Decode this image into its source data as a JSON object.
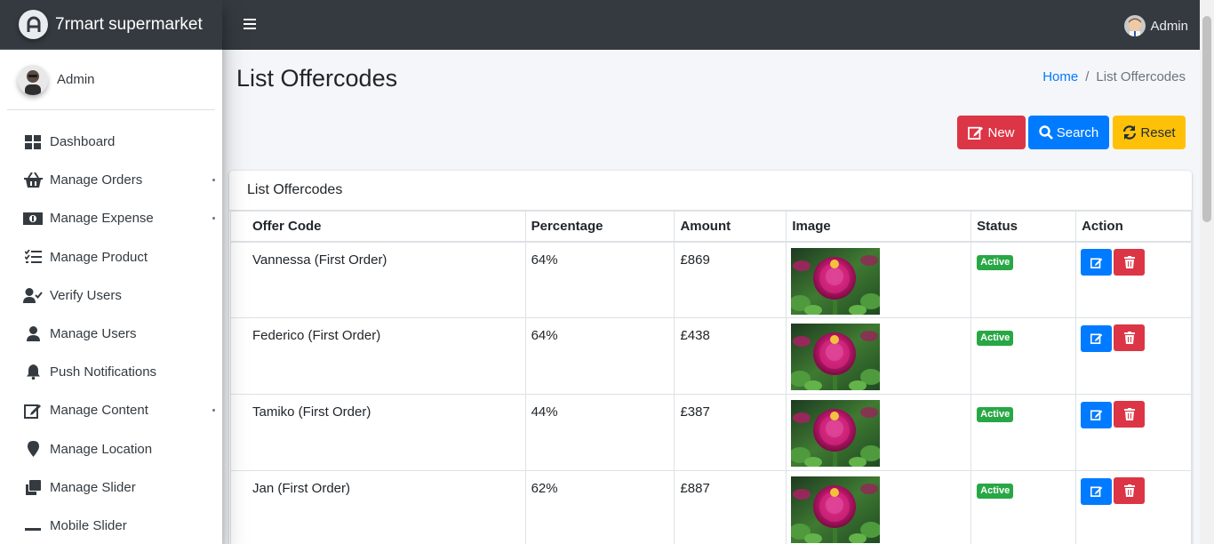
{
  "brand": {
    "name": "7rmart supermarket"
  },
  "sidebar": {
    "user": "Admin",
    "items": [
      {
        "label": "Dashboard",
        "icon": "dashboard-icon",
        "has_submenu": false
      },
      {
        "label": "Manage Orders",
        "icon": "basket-icon",
        "has_submenu": true
      },
      {
        "label": "Manage Expense",
        "icon": "money-bill-icon",
        "has_submenu": true
      },
      {
        "label": "Manage Product",
        "icon": "tasks-icon",
        "has_submenu": false
      },
      {
        "label": "Verify Users",
        "icon": "user-check-icon",
        "has_submenu": false
      },
      {
        "label": "Manage Users",
        "icon": "user-icon",
        "has_submenu": false
      },
      {
        "label": "Push Notifications",
        "icon": "bell-icon",
        "has_submenu": false
      },
      {
        "label": "Manage Content",
        "icon": "edit-icon",
        "has_submenu": true
      },
      {
        "label": "Manage Location",
        "icon": "map-marker-icon",
        "has_submenu": false
      },
      {
        "label": "Manage Slider",
        "icon": "clone-icon",
        "has_submenu": false
      },
      {
        "label": "Mobile Slider",
        "icon": "minus-icon",
        "has_submenu": false
      }
    ]
  },
  "topbar": {
    "user": "Admin"
  },
  "page": {
    "title": "List Offercodes",
    "breadcrumb": {
      "home": "Home",
      "separator": "/",
      "current": "List Offercodes"
    }
  },
  "buttons": {
    "new": "New",
    "search": "Search",
    "reset": "Reset"
  },
  "card": {
    "title": "List Offercodes"
  },
  "table": {
    "headers": [
      "Offer Code",
      "Percentage",
      "Amount",
      "Image",
      "Status",
      "Action"
    ],
    "rows": [
      {
        "offer_code": "Vannessa (First Order)",
        "percentage": "64%",
        "amount": "£869",
        "status": "Active"
      },
      {
        "offer_code": "Federico (First Order)",
        "percentage": "64%",
        "amount": "£438",
        "status": "Active"
      },
      {
        "offer_code": "Tamiko (First Order)",
        "percentage": "44%",
        "amount": "£387",
        "status": "Active"
      },
      {
        "offer_code": "Jan (First Order)",
        "percentage": "62%",
        "amount": "£887",
        "status": "Active"
      }
    ]
  },
  "colors": {
    "topbar": "#343a40",
    "primary": "#007bff",
    "danger": "#dc3545",
    "warning": "#ffc107",
    "success": "#28a745"
  }
}
